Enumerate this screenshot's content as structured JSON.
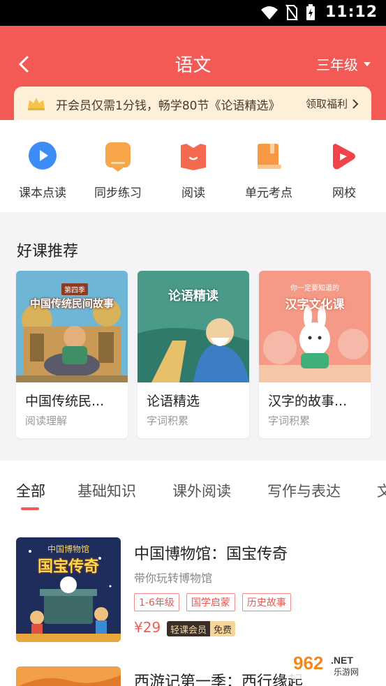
{
  "status": {
    "time": "11:12"
  },
  "header": {
    "title": "语文",
    "grade": "三年级"
  },
  "vip": {
    "text": "开会员仅需1分钱，畅学80节《论语精选》",
    "cta": "领取福利"
  },
  "quick": [
    {
      "label": "课本点读",
      "icon": "play-bubble-icon",
      "color": "#3d8cf5"
    },
    {
      "label": "同步练习",
      "icon": "note-icon",
      "color": "#f7a74a"
    },
    {
      "label": "阅读",
      "icon": "book-open-icon",
      "color": "#f4694f"
    },
    {
      "label": "单元考点",
      "icon": "book-stack-icon",
      "color": "#f79845"
    },
    {
      "label": "网校",
      "icon": "play-ribbon-icon",
      "color": "#f1434b"
    }
  ],
  "recommend": {
    "title": "好课推荐",
    "cards": [
      {
        "name": "中国传统民...",
        "tag": "阅读理解",
        "cover_text": "中国传统民间故事",
        "cover_badge": "第四季"
      },
      {
        "name": "论语精选",
        "tag": "字词积累",
        "cover_text": "论语精读"
      },
      {
        "name": "汉字的故事...",
        "tag": "字词积累",
        "cover_text": "汉字文化课",
        "cover_badge": "你一定要知道的"
      }
    ]
  },
  "tabs": [
    "全部",
    "基础知识",
    "课外阅读",
    "写作与表达",
    "文"
  ],
  "courses": [
    {
      "title": "中国博物馆：国宝传奇",
      "subtitle": "带你玩转博物馆",
      "chips": [
        "1-6年级",
        "国学启蒙",
        "历史故事"
      ],
      "price": "¥29",
      "vip_label": "轻课会员",
      "free_label": "免费",
      "cover_top": "中国博物馆",
      "cover_main": "国宝传奇"
    },
    {
      "title": "西游记第一季：西行缘起"
    }
  ],
  "watermark": {
    "text1": "962",
    "text2": ".NET",
    "text3": "乐游网"
  },
  "colors": {
    "accent": "#f45a55",
    "vip_bg": "#fdf0d9"
  }
}
